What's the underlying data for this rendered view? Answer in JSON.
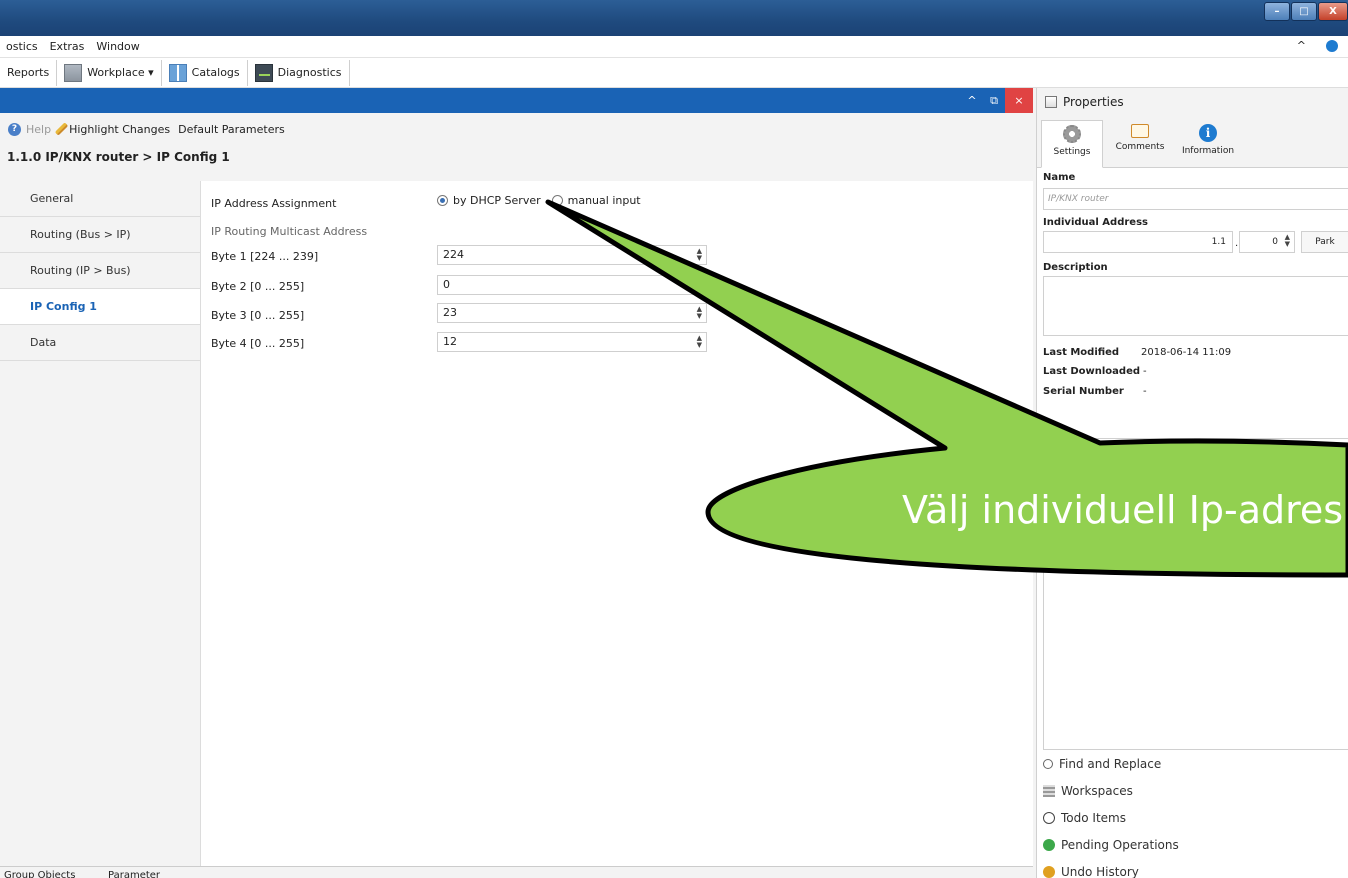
{
  "window": {
    "minimize": "–",
    "maximize": "□",
    "close": "X"
  },
  "menu": [
    "ostics",
    "Extras",
    "Window"
  ],
  "menu_right": {
    "collapse": "^"
  },
  "toolbar": {
    "reports": "Reports",
    "workplace": "Workplace ▾",
    "catalogs": "Catalogs",
    "diagnostics": "Diagnostics"
  },
  "panel": {
    "collapse": "^",
    "restore": "⧉",
    "close": "×"
  },
  "subbar": {
    "help": "Help",
    "highlight": "Highlight Changes",
    "defaults": "Default Parameters"
  },
  "breadcrumb": "1.1.0 IP/KNX router > IP Config 1",
  "nav": [
    {
      "label": "General"
    },
    {
      "label": "Routing (Bus > IP)"
    },
    {
      "label": "Routing (IP > Bus)"
    },
    {
      "label": "IP Config 1"
    },
    {
      "label": "Data"
    }
  ],
  "form": {
    "ip_assignment_label": "IP Address Assignment",
    "dhcp_label": "by DHCP Server",
    "manual_label": "manual input",
    "multicast_label": "IP Routing Multicast Address",
    "bytes": [
      {
        "label": "Byte 1 [224 ... 239]",
        "value": "224"
      },
      {
        "label": "Byte 2 [0 ... 255]",
        "value": "0"
      },
      {
        "label": "Byte 3 [0 ... 255]",
        "value": "23"
      },
      {
        "label": "Byte 4 [0 ... 255]",
        "value": "12"
      }
    ]
  },
  "bottom_tabs": [
    "Group Objects",
    "Parameter"
  ],
  "properties": {
    "title": "Properties",
    "tabs": [
      "Settings",
      "Comments",
      "Information"
    ],
    "name_label": "Name",
    "name_placeholder": "IP/KNX router",
    "individual_address_label": "Individual Address",
    "address_prefix": "1.1",
    "address_dot": ".",
    "address_value": "0",
    "park_button": "Park",
    "description_label": "Description",
    "last_modified_label": "Last Modified",
    "last_modified_value": "2018-06-14 11:09",
    "last_downloaded_label": "Last Downloaded",
    "last_downloaded_value": "-",
    "serial_label": "Serial Number",
    "serial_value": "-"
  },
  "panes": [
    "Find and Replace",
    "Workspaces",
    "Todo Items",
    "Pending Operations",
    "Undo History"
  ],
  "callout": {
    "text": "Välj individuell Ip-adres",
    "fill_color": "#92d050"
  }
}
